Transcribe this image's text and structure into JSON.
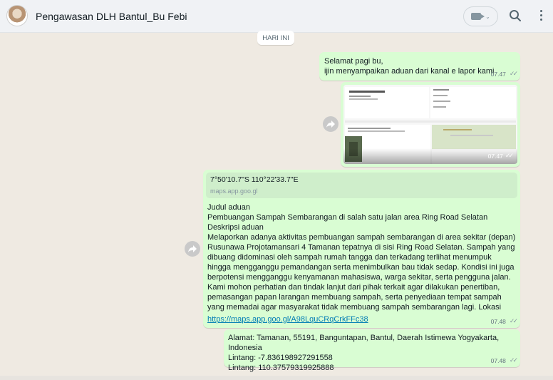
{
  "header": {
    "title": "Pengawasan DLH Bantul_Bu Febi",
    "icons": [
      "avatar",
      "video-camera-icon",
      "chevron-down-icon",
      "search-icon",
      "menu-icon"
    ]
  },
  "day_badge": "HARI INI",
  "messages": [
    {
      "text": "Selamat pagi bu,\nijin menyampaikan aduan dari kanal e lapor kami",
      "time": "07.47"
    },
    {
      "type": "image",
      "time": "07.47"
    },
    {
      "type": "location",
      "location_title": "7°50'10.7\"S 110°22'33.7\"E",
      "location_url": "maps.app.goo.gl",
      "text": "Judul aduan\nPembuangan Sampah Sembarangan di salah satu jalan area Ring Road Selatan\nDeskripsi aduan\nMelaporkan adanya aktivitas pembuangan sampah sembarangan di area sekitar (depan) Rusunawa Projotamansari 4 Tamanan tepatnya di sisi Ring Road Selatan. Sampah yang dibuang didominasi oleh sampah rumah tangga dan terkadang terlihat menumpuk hingga mengganggu pemandangan serta menimbulkan bau tidak sedap. Kondisi ini juga berpotensi mengganggu kenyamanan mahasiswa, warga sekitar, serta pengguna jalan. Kami mohon perhatian dan tindak lanjut dari pihak terkait agar dilakukan penertiban, pemasangan papan larangan membuang sampah, serta penyediaan tempat sampah yang memadai agar masyarakat tidak membuang sampah sembarangan lagi. Lokasi",
      "link": "https://maps.app.goo.gl/A98LquCRqCrkFFc38",
      "time": "07.48"
    },
    {
      "text": "Alamat: Tamanan, 55191, Banguntapan, Bantul, Daerah Istimewa Yogyakarta, Indonesia\nLintang: -7.836198927291558\nLintang: 110.37579319925888",
      "time": "07.48"
    }
  ],
  "colors": {
    "chat_bg": "#efeae2",
    "bubble_out": "#d9fdd3",
    "header_bg": "#f0f2f5",
    "link": "#027eb5"
  }
}
